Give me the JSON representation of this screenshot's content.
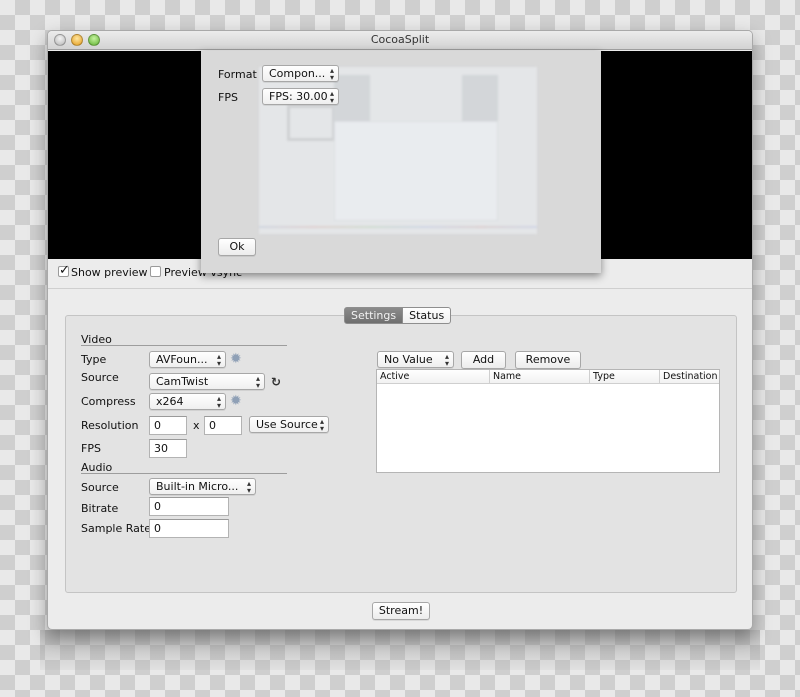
{
  "window": {
    "title": "CocoaSplit",
    "traffic_lights": [
      "close",
      "minimize",
      "zoom"
    ]
  },
  "sheet": {
    "format_label": "Format",
    "format_value": "Compon...",
    "fps_label": "FPS",
    "fps_value": "FPS: 30.00",
    "ok_label": "Ok"
  },
  "preview_options": {
    "show_preview_label": "Show preview",
    "show_preview_checked": true,
    "preview_vsync_label": "Preview vsync",
    "preview_vsync_checked": false
  },
  "tabs": [
    {
      "label": "Settings",
      "active": true
    },
    {
      "label": "Status",
      "active": false
    }
  ],
  "video": {
    "section_label": "Video",
    "type_label": "Type",
    "type_value": "AVFoun...",
    "source_label": "Source",
    "source_value": "CamTwist",
    "compress_label": "Compress",
    "compress_value": "x264",
    "resolution_label": "Resolution",
    "resolution_width": "0",
    "resolution_x": "x",
    "resolution_height": "0",
    "resolution_mode": "Use Source",
    "fps_label": "FPS",
    "fps_value": "30"
  },
  "audio": {
    "section_label": "Audio",
    "source_label": "Source",
    "source_value": "Built-in Micro...",
    "bitrate_label": "Bitrate",
    "bitrate_value": "0",
    "sample_rate_label": "Sample Rate",
    "sample_rate_value": "0"
  },
  "outputs": {
    "selector_value": "No Value",
    "add_label": "Add",
    "remove_label": "Remove",
    "columns": [
      "Active",
      "Name",
      "Type",
      "Destination"
    ],
    "rows": []
  },
  "footer": {
    "stream_label": "Stream!"
  },
  "icons": {
    "popup_arrows": "⬍",
    "gear": "✹",
    "refresh": "↻",
    "check": "✓"
  }
}
